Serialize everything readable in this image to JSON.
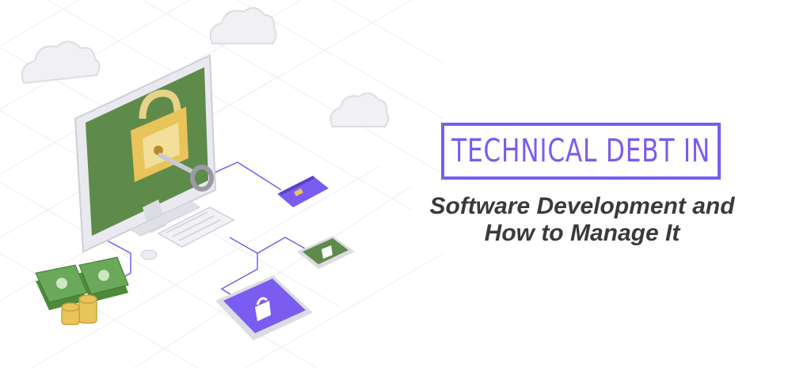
{
  "title": {
    "line1": "TECHNICAL DEBT IN",
    "line2": "Software Development and",
    "line3": "How to Manage It"
  },
  "colors": {
    "accent": "#7b5cf0",
    "screen_green": "#5e8b4a",
    "lock_gold": "#e8c45a",
    "money_green": "#5a9a4a",
    "text_dark": "#3a3a3a"
  },
  "icons": [
    "cloud-icon",
    "padlock-icon",
    "key-icon",
    "credit-card-icon",
    "tablet-lock-icon",
    "money-stack-icon",
    "coin-stack-icon"
  ]
}
